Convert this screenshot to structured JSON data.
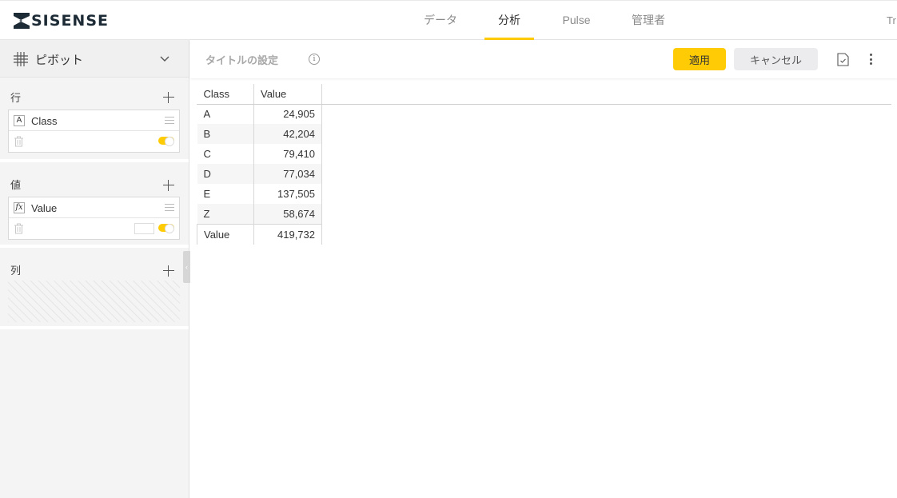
{
  "app": {
    "logo_text": "SISENSE"
  },
  "nav": {
    "tabs": [
      {
        "label": "データ"
      },
      {
        "label": "分析"
      },
      {
        "label": "Pulse"
      },
      {
        "label": "管理者"
      }
    ],
    "active_tab": "分析",
    "truncated": "Tr"
  },
  "left_panel": {
    "widget_type": "ピボット",
    "rows": {
      "title": "行",
      "field": {
        "type_glyph": "A",
        "name": "Class"
      }
    },
    "values": {
      "title": "値",
      "field": {
        "type_glyph": "fx",
        "name": "Value"
      }
    },
    "columns": {
      "title": "列"
    }
  },
  "widget_header": {
    "title_placeholder": "タイトルの設定",
    "apply_label": "適用",
    "cancel_label": "キャンセル"
  },
  "pivot": {
    "headers": [
      "Class",
      "Value"
    ],
    "rows": [
      {
        "class": "A",
        "value": "24,905"
      },
      {
        "class": "B",
        "value": "42,204"
      },
      {
        "class": "C",
        "value": "79,410"
      },
      {
        "class": "D",
        "value": "77,034"
      },
      {
        "class": "E",
        "value": "137,505"
      },
      {
        "class": "Z",
        "value": "58,674"
      }
    ],
    "total": {
      "label": "Value",
      "value": "419,732"
    }
  },
  "colors": {
    "accent": "#ffcb05",
    "panel_bg": "#f4f4f4"
  }
}
